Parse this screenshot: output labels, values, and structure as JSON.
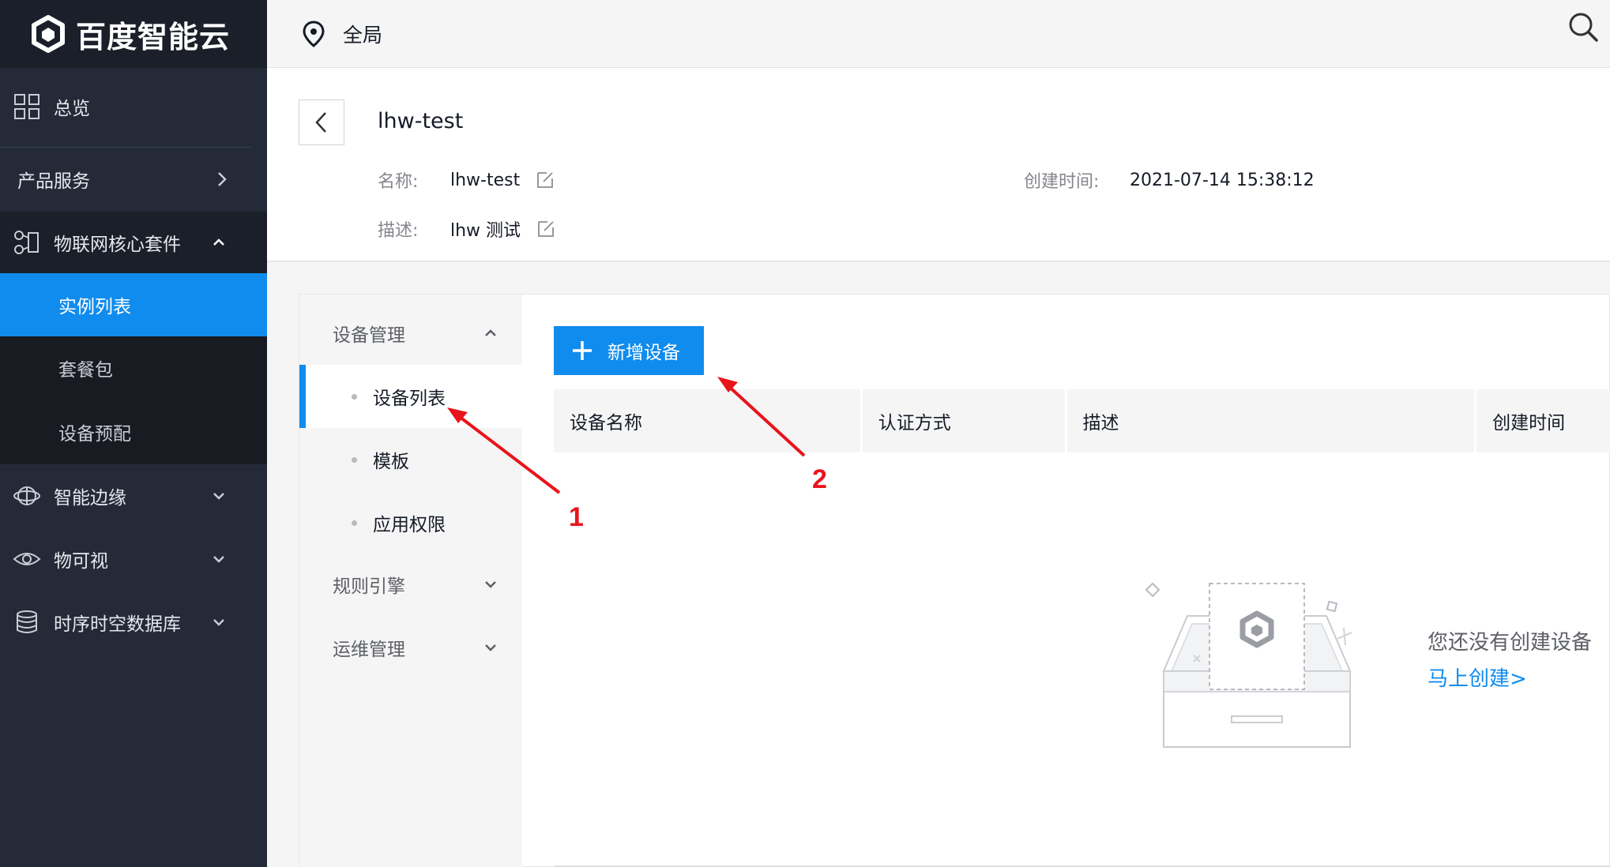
{
  "brand": {
    "name": "百度智能云"
  },
  "topbar": {
    "region": "全局"
  },
  "nav": {
    "overview": "总览",
    "products": "产品服务",
    "iot_core": "物联网核心套件",
    "iot_sub": [
      "实例列表",
      "套餐包",
      "设备预配"
    ],
    "edge": "智能边缘",
    "visual": "物可视",
    "tsdb": "时序时空数据库"
  },
  "instance": {
    "title": "lhw-test",
    "name_label": "名称:",
    "name_value": "lhw-test",
    "desc_label": "描述:",
    "desc_value": "lhw 测试",
    "created_label": "创建时间:",
    "created_value": "2021-07-14 15:38:12"
  },
  "subnav": {
    "device_mgmt": "设备管理",
    "device_items": [
      "设备列表",
      "模板",
      "应用权限"
    ],
    "rules": "规则引擎",
    "ops": "运维管理"
  },
  "toolbar": {
    "add_device": "新增设备"
  },
  "table": {
    "columns": [
      "设备名称",
      "认证方式",
      "描述",
      "创建时间"
    ]
  },
  "empty": {
    "message": "您还没有创建设备",
    "link": "马上创建>"
  },
  "annotations": {
    "marker_1": "1",
    "marker_2": "2"
  },
  "colors": {
    "accent": "#108cee",
    "nav_bg": "#242a38",
    "annotation": "#e8141b"
  }
}
